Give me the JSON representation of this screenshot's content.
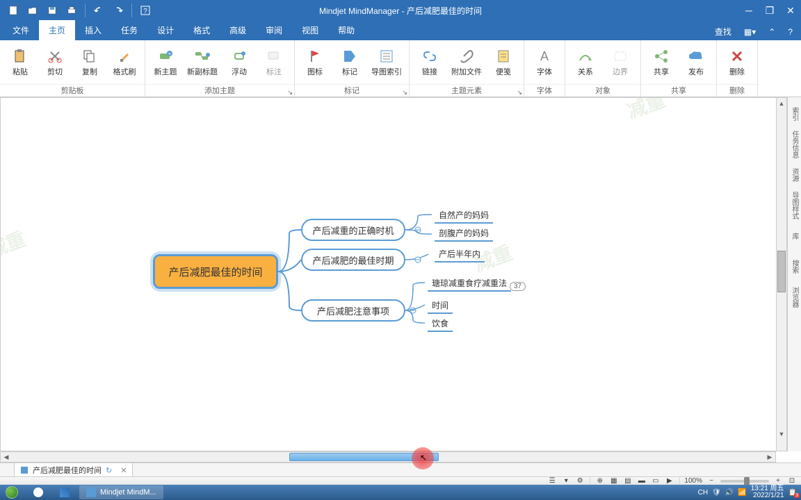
{
  "app": {
    "title": "Mindjet MindManager - 产后减肥最佳的时间"
  },
  "menu": {
    "tabs": [
      "文件",
      "主页",
      "插入",
      "任务",
      "设计",
      "格式",
      "高级",
      "审阅",
      "视图",
      "帮助"
    ],
    "active_index": 1,
    "search": "查找"
  },
  "ribbon": {
    "groups": [
      {
        "label": "剪贴板",
        "buttons": [
          "粘贴",
          "剪切",
          "复制",
          "格式刷"
        ]
      },
      {
        "label": "添加主题",
        "buttons": [
          "新主题",
          "新副标题",
          "浮动",
          "标注"
        ]
      },
      {
        "label": "标记",
        "buttons": [
          "图标",
          "标记",
          "导图索引"
        ]
      },
      {
        "label": "主题元素",
        "buttons": [
          "链接",
          "附加文件",
          "便笺"
        ]
      },
      {
        "label": "字体",
        "buttons": [
          "字体"
        ]
      },
      {
        "label": "对象",
        "buttons": [
          "关系",
          "边界"
        ]
      },
      {
        "label": "共享",
        "buttons": [
          "共享",
          "发布"
        ]
      },
      {
        "label": "删除",
        "buttons": [
          "删除"
        ]
      }
    ]
  },
  "mindmap": {
    "central": "产后减肥最佳的时间",
    "main": [
      {
        "label": "产后减重的正确时机",
        "subs": [
          "自然产的妈妈",
          "剖腹产的妈妈"
        ]
      },
      {
        "label": "产后减肥的最佳时期",
        "subs": [
          "产后半年内"
        ]
      },
      {
        "label": "产后减肥注意事项",
        "subs": [
          "瑭琼减重食疗减重法",
          "时间",
          "饮食"
        ]
      }
    ],
    "badge": "37"
  },
  "sidebar_right": [
    "索引",
    "任务信息",
    "资源",
    "导图样式",
    "库",
    "搜索",
    "浏览器"
  ],
  "doc_tab": {
    "name": "产后减肥最佳的时间"
  },
  "statusbar": {
    "zoom": "100%"
  },
  "taskbar": {
    "app_name": "Mindjet MindM...",
    "lang": "CH",
    "time": "13:21",
    "day": "周五",
    "date": "2022/1/21",
    "notif": "3"
  },
  "watermark": "减重"
}
